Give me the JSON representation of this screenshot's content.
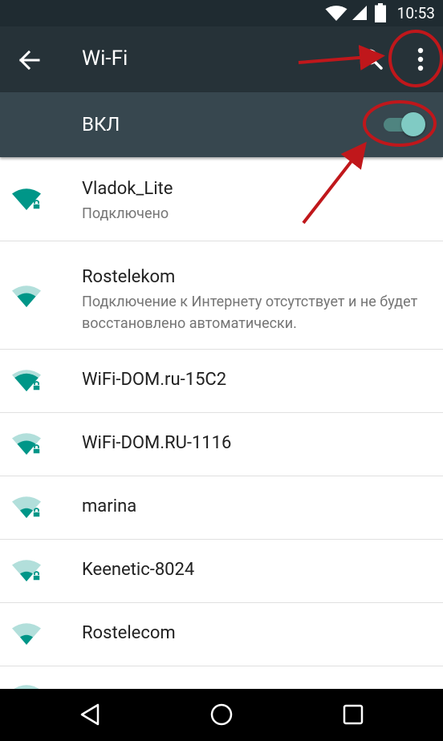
{
  "status_bar": {
    "time": "10:53"
  },
  "app_bar": {
    "title": "Wi-Fi"
  },
  "toggle": {
    "label": "ВКЛ",
    "on": true
  },
  "networks": [
    {
      "name": "Vladok_Lite",
      "status": "Подключено"
    },
    {
      "name": "Rostelekom",
      "status": "Подключение к Интернету отсутствует и не будет восстановлено автоматически."
    },
    {
      "name": "WiFi-DOM.ru-15C2"
    },
    {
      "name": "WiFi-DOM.RU-1116"
    },
    {
      "name": "marina"
    },
    {
      "name": "Keenetic-8024"
    },
    {
      "name": "Rostelecom"
    }
  ],
  "colors": {
    "app_bar": "#263238",
    "toggle_bar": "#37474f",
    "accent": "#009688",
    "annotation": "#c0171b"
  },
  "icons": [
    "back-arrow",
    "search",
    "overflow-menu",
    "wifi-signal",
    "lock",
    "nav-back",
    "nav-home",
    "nav-recents"
  ]
}
